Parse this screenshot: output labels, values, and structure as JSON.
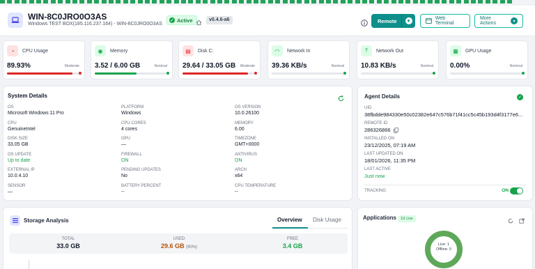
{
  "colors": {
    "accent": "#0e8f8a",
    "danger": "#dc2626",
    "success": "#16a34a"
  },
  "header": {
    "device_name": "WIN-8C0JRO0O3AS",
    "device_subtitle": "Windows TEST BOX(185.116.237.164) - WIN-8C0JRO0O3AS",
    "status_badge": "Active",
    "version": "v0.4.6-a6",
    "remote_button": "Remote",
    "web_terminal_button": "Web Terminal",
    "more_actions_button": "More Actions"
  },
  "metrics": [
    {
      "label": "CPU Usage",
      "value": "89.93%",
      "status": "Moderate",
      "fill": 0.9,
      "color": "#dc2626",
      "icon": "gauge-icon"
    },
    {
      "label": "Memory",
      "value": "3.52 / 6.00 GB",
      "status": "Nominal",
      "fill": 0.58,
      "color": "#16a34a",
      "icon": "memory-icon"
    },
    {
      "label": "Disk C:",
      "value": "29.64 / 33.05 GB",
      "status": "Moderate",
      "fill": 0.9,
      "color": "#dc2626",
      "icon": "disk-icon"
    },
    {
      "label": "Network In",
      "value": "39.36 KB/s",
      "status": "Nominal",
      "fill": 0.0,
      "color": "#16a34a",
      "icon": "wifi-icon"
    },
    {
      "label": "Network Out",
      "value": "10.83 KB/s",
      "status": "Nominal",
      "fill": 0.0,
      "color": "#16a34a",
      "icon": "upload-icon"
    },
    {
      "label": "GPU Usage",
      "value": "0.00%",
      "status": "Nominal",
      "fill": 0.0,
      "color": "#16a34a",
      "icon": "gpu-icon"
    }
  ],
  "system_details": {
    "title": "System Details",
    "items": [
      {
        "k": "OS",
        "v": "Microsoft Windows 11 Pro"
      },
      {
        "k": "PLATFORM",
        "v": "Windows"
      },
      {
        "k": "OS VERSION",
        "v": "10.0.26100"
      },
      {
        "k": "CPU",
        "v": "GenuineIntel"
      },
      {
        "k": "CPU CORES",
        "v": "4 cores"
      },
      {
        "k": "MEMORY",
        "v": "6.00"
      },
      {
        "k": "DISK SIZE",
        "v": "33.05 GB"
      },
      {
        "k": "GPU",
        "v": "—"
      },
      {
        "k": "TIMEZONE",
        "v": "GMT+0000"
      },
      {
        "k": "OS UPDATE",
        "v": "Up to date"
      },
      {
        "k": "FIREWALL",
        "v": "ON"
      },
      {
        "k": "ANTIVIRUS",
        "v": "ON"
      },
      {
        "k": "EXTERNAL IP",
        "v": "10.0.4.10"
      },
      {
        "k": "PENDING UPDATES",
        "v": "No"
      },
      {
        "k": "ARCH",
        "v": "x64"
      },
      {
        "k": "SENSOR",
        "v": "—"
      },
      {
        "k": "BATTERY PERCENT",
        "v": "--"
      },
      {
        "k": "CPU TEMPERATURE",
        "v": "--"
      }
    ]
  },
  "agent_details": {
    "title": "Agent Details",
    "uid_label": "UID",
    "uid": "38fbdde984330e50c02382e647c576b71f41cc5c45b193d4f3177e6...",
    "remote_id_label": "REMOTE ID",
    "remote_id": "286326866",
    "installed_label": "INSTALLED ON",
    "installed": "23/12/2025, 07:19 AM",
    "updated_label": "LAST UPDATED ON",
    "updated": "18/01/2026, 11:35 PM",
    "last_active_label": "LAST ACTIVE",
    "last_active": "Just now",
    "tracking_label": "TRACKING",
    "tracking_state": "ON"
  },
  "storage": {
    "title": "Storage Analysis",
    "tabs": [
      "Overview",
      "Disk Usage"
    ],
    "total_label": "TOTAL",
    "total": "33.0 GB",
    "used_label": "USED",
    "used": "29.6 GB",
    "used_pct": "(90%)",
    "free_label": "FREE",
    "free": "3.4 GB"
  },
  "applications": {
    "title": "Applications",
    "live_badge": "1/1 Live",
    "live_text": "Live: 1",
    "offline_text": "Offline: 0"
  }
}
